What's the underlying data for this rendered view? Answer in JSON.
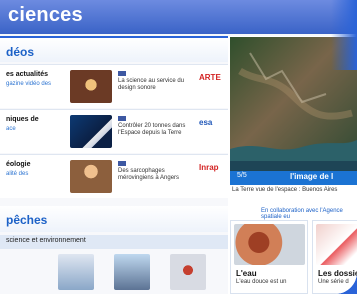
{
  "header": {
    "brand": "ciences"
  },
  "sections": {
    "videos_title": "déos",
    "depeches_title": "pêches",
    "depeches_subhead": "science et environnement"
  },
  "videos": [
    {
      "title": "es actualités",
      "subtitle": "gazine vidéo des",
      "text": "La science au service du design sonore",
      "logo": "ARTE",
      "logo_color": "#d32323"
    },
    {
      "title": "niques de",
      "subtitle": "ace",
      "text": "Contrôler 20 tonnes dans l'Espace depuis la Terre",
      "logo": "esa",
      "logo_color": "#1f56b8"
    },
    {
      "title": "éologie",
      "subtitle": "alité des",
      "text": "Des sarcophages mérovingiens à Angers",
      "logo": "Inrap",
      "logo_color": "#d32323"
    }
  ],
  "image_panel": {
    "counter": "5/5",
    "title": "l'image de l",
    "caption": "La Terre vue de l'espace : Buenos Aires",
    "credit": "En collaboration avec l'Agence spatiale eu"
  },
  "cards": [
    {
      "title": "L'eau",
      "subtitle": "L'eau douce est un"
    },
    {
      "title": "Les dossie",
      "subtitle": "Une série d"
    }
  ]
}
